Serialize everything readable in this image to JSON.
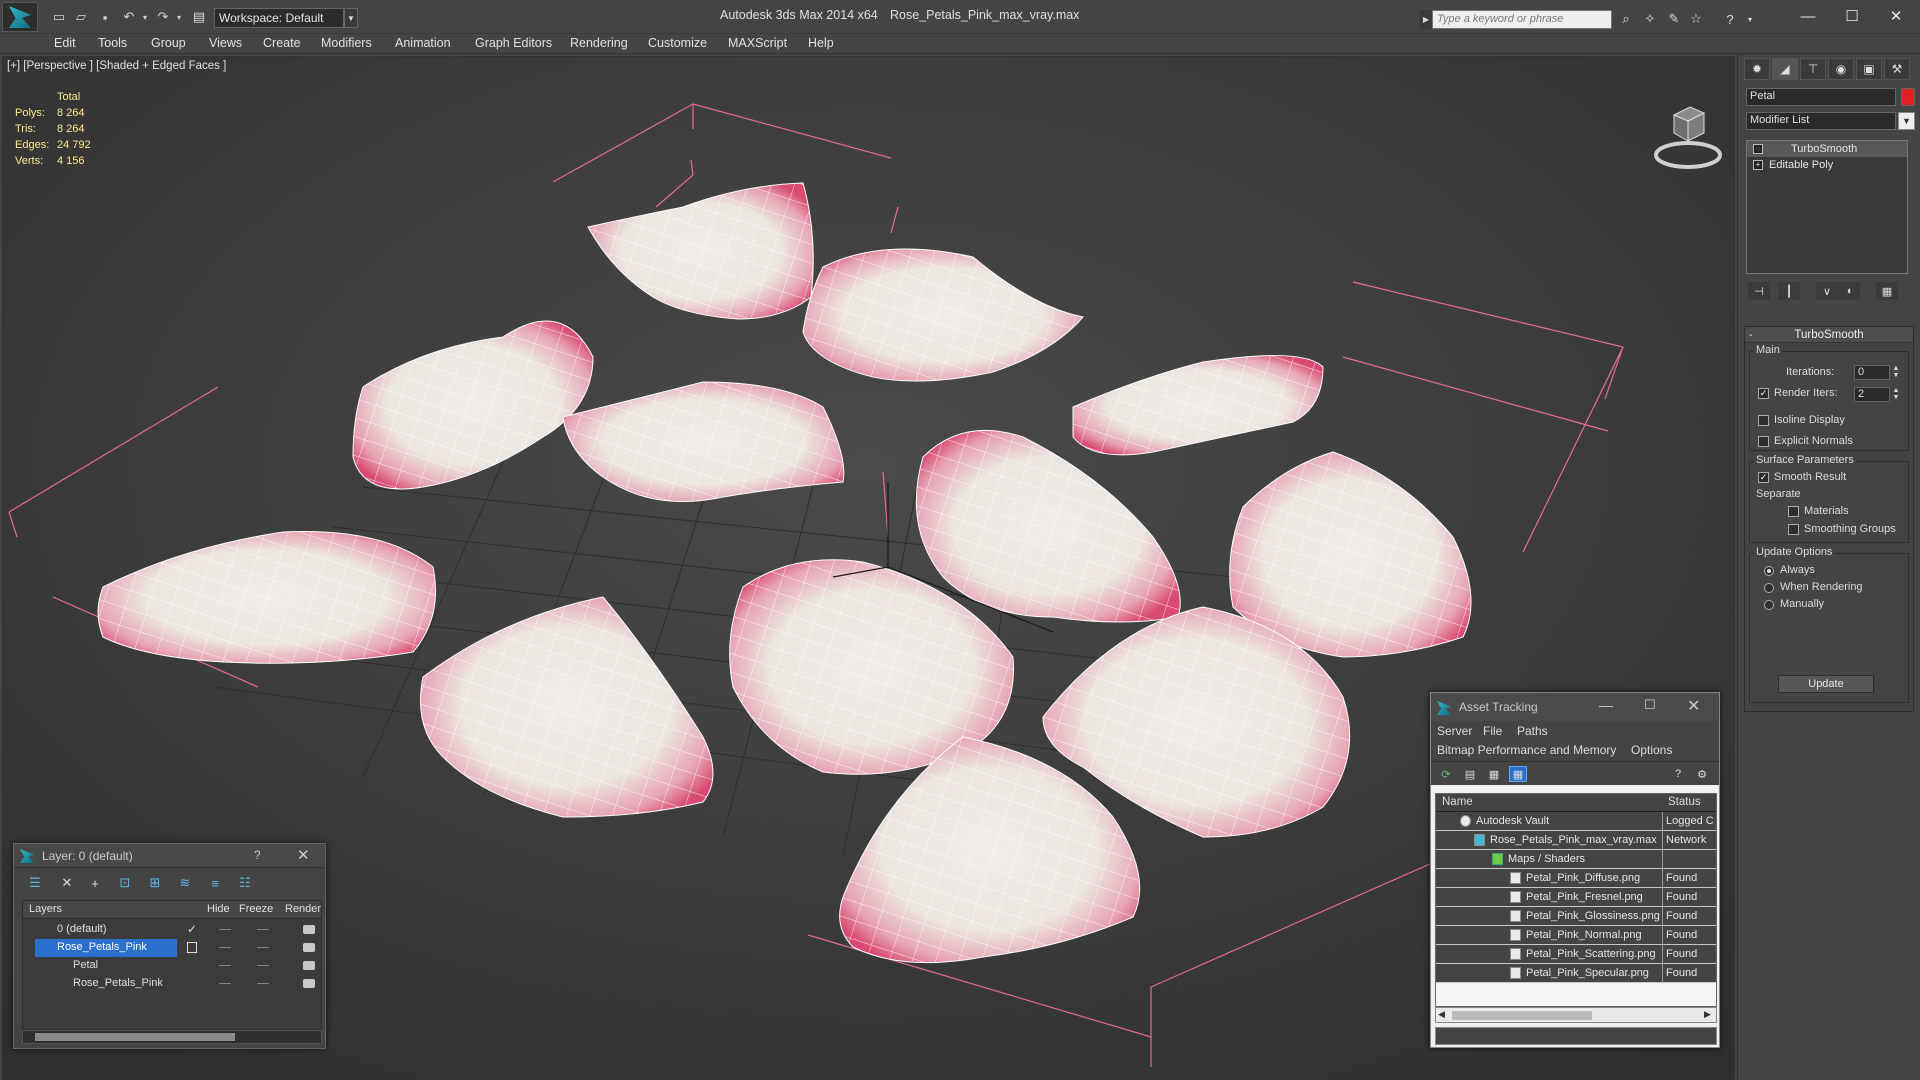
{
  "titlebar": {
    "workspace": "Workspace: Default",
    "app_title": "Autodesk 3ds Max  2014 x64",
    "file_title": "Rose_Petals_Pink_max_vray.max",
    "search_placeholder": "Type a keyword or phrase"
  },
  "menu": [
    "Edit",
    "Tools",
    "Group",
    "Views",
    "Create",
    "Modifiers",
    "Animation",
    "Graph Editors",
    "Rendering",
    "Customize",
    "MAXScript",
    "Help"
  ],
  "viewport": {
    "label": "[+] [Perspective ] [Shaded + Edged Faces ]",
    "stats": {
      "header": "Total",
      "rows": [
        {
          "k": "Polys:",
          "v": "8 264"
        },
        {
          "k": "Tris:",
          "v": "8 264"
        },
        {
          "k": "Edges:",
          "v": "24 792"
        },
        {
          "k": "Verts:",
          "v": "4 156"
        }
      ]
    }
  },
  "command_panel": {
    "object_name": "Petal",
    "object_color": "#e02020",
    "modifier_list": "Modifier List",
    "stack": [
      "TurboSmooth",
      "Editable Poly"
    ],
    "rollout_title": "TurboSmooth",
    "main_group": "Main",
    "iterations_label": "Iterations:",
    "iterations_value": "0",
    "render_iters_label": "Render Iters:",
    "render_iters_value": "2",
    "isoline_label": "Isoline Display",
    "explicit_normals_label": "Explicit Normals",
    "surface_group": "Surface Parameters",
    "smooth_result_label": "Smooth Result",
    "separate_label": "Separate",
    "materials_label": "Materials",
    "smoothing_groups_label": "Smoothing Groups",
    "update_group": "Update Options",
    "always_label": "Always",
    "when_rendering_label": "When Rendering",
    "manually_label": "Manually",
    "update_button": "Update"
  },
  "layer_dialog": {
    "title": "Layer: 0 (default)",
    "help": "?",
    "columns": {
      "layers": "Layers",
      "hide": "Hide",
      "freeze": "Freeze",
      "render": "Render"
    },
    "rows": [
      "0 (default)",
      "Rose_Petals_Pink",
      "Petal",
      "Rose_Petals_Pink"
    ]
  },
  "asset_tracking": {
    "title": "Asset Tracking",
    "menu1": [
      "Server",
      "File",
      "Paths"
    ],
    "menu2": [
      "Bitmap Performance and Memory",
      "Options"
    ],
    "columns": {
      "name": "Name",
      "status": "Status"
    },
    "rows": [
      {
        "name": "Autodesk Vault",
        "status": "Logged C"
      },
      {
        "name": "Rose_Petals_Pink_max_vray.max",
        "status": "Network"
      },
      {
        "name": "Maps / Shaders",
        "status": ""
      },
      {
        "name": "Petal_Pink_Diffuse.png",
        "status": "Found"
      },
      {
        "name": "Petal_Pink_Fresnel.png",
        "status": "Found"
      },
      {
        "name": "Petal_Pink_Glossiness.png",
        "status": "Found"
      },
      {
        "name": "Petal_Pink_Normal.png",
        "status": "Found"
      },
      {
        "name": "Petal_Pink_Scattering.png",
        "status": "Found"
      },
      {
        "name": "Petal_Pink_Specular.png",
        "status": "Found"
      }
    ]
  }
}
